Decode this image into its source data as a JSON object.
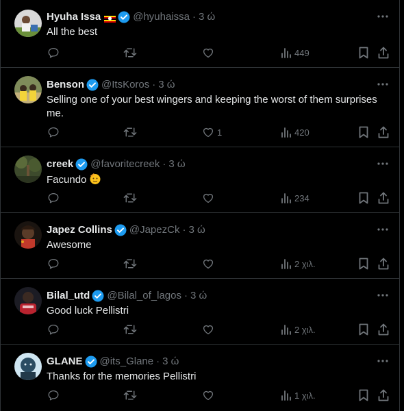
{
  "icons": {
    "reply": "reply-icon",
    "retweet": "retweet-icon",
    "like": "like-icon",
    "views": "views-icon",
    "bookmark": "bookmark-icon",
    "share": "share-icon",
    "more": "more-icon",
    "verified": "verified-badge-icon"
  },
  "colors": {
    "verified": "#1d9bf0",
    "muted": "#71767b",
    "text": "#e7e9ea",
    "border": "#2f3336"
  },
  "tweets": [
    {
      "name": "Hyuha Issa",
      "handle": "@hyuhaissa",
      "dot": "·",
      "time": "3 ώ",
      "text": "All the best",
      "likes": "",
      "views": "449"
    },
    {
      "name": "Benson",
      "handle": "@ItsKoros",
      "dot": "·",
      "time": "3 ώ",
      "text": "Selling one of your best wingers and keeping the worst of them surprises me.",
      "likes": "1",
      "views": "420"
    },
    {
      "name": "creek",
      "handle": "@favoritecreek",
      "dot": "·",
      "time": "3 ώ",
      "text": "Facundo",
      "likes": "",
      "views": "234"
    },
    {
      "name": "Japez Collins",
      "handle": "@JapezCk",
      "dot": "·",
      "time": "3 ώ",
      "text": "Awesome",
      "likes": "",
      "views": "2 χιλ."
    },
    {
      "name": "Bilal_utd",
      "handle": "@Bilal_of_lagos",
      "dot": "·",
      "time": "3 ώ",
      "text": "Good luck Pellistri",
      "likes": "",
      "views": "2 χιλ."
    },
    {
      "name": "GLANE",
      "handle": "@its_Glane",
      "dot": "·",
      "time": "3 ώ",
      "text": "Thanks for the memories Pellistri",
      "likes": "",
      "views": "1 χιλ."
    }
  ]
}
